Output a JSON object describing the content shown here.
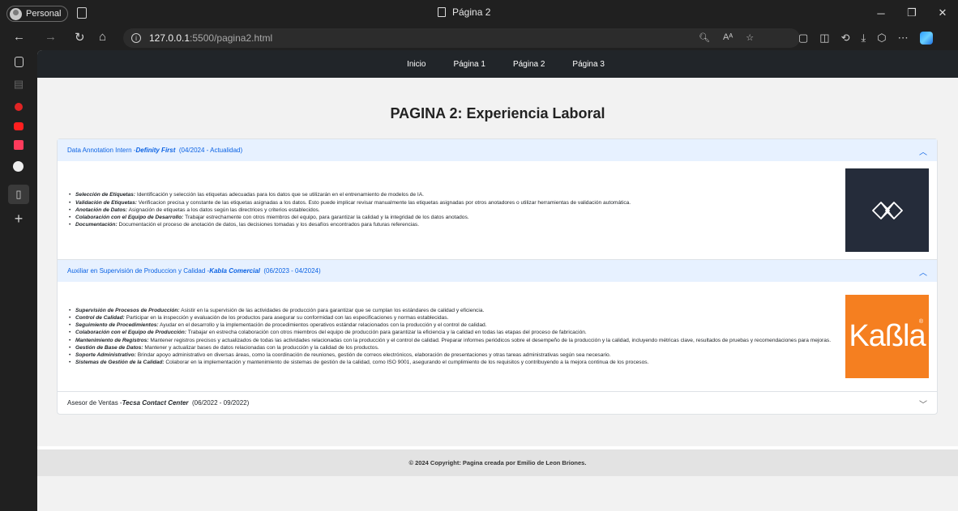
{
  "browser": {
    "profile_label": "Personal",
    "window_title": "Página 2",
    "url_host": "127.0.0.1",
    "url_path": ":5500/pagina2.html",
    "icons": [
      "back-icon",
      "forward-icon",
      "refresh-icon",
      "home-icon",
      "info-icon",
      "zoom-icon",
      "read-aloud-icon",
      "favorite-icon",
      "collections-icon",
      "split-screen-icon",
      "history-icon",
      "downloads-icon",
      "extensions-icon",
      "more-icon",
      "copilot-icon"
    ]
  },
  "sidebar": {
    "icons": [
      "tabs-icon",
      "workspace-icon",
      "youtube-icon",
      "youtube-icon",
      "app-icon",
      "github-icon",
      "page-icon",
      "add-icon"
    ]
  },
  "nav": {
    "links": [
      "Inicio",
      "Página 1",
      "Página 2",
      "Página 3"
    ]
  },
  "page": {
    "title": "PAGINA 2: Experiencia Laboral",
    "footer": "© 2024 Copyright: Pagina creada por Emilio de Leon Briones."
  },
  "jobs": [
    {
      "title": "Data Annotation Intern - ",
      "company": "Definity First",
      "dates": "  (04/2024 - Actualidad)",
      "expanded": true,
      "logo": "definity-first-logo",
      "duties": [
        {
          "label": "Selección de Etiquetas:",
          "text": " Identificación y selección las etiquetas adecuadas para los datos que se utilizarán en el entrenamiento de modelos de IA."
        },
        {
          "label": "Validación de Etiquetas:",
          "text": " Verificacion precisa y constante de las etiquetas asignadas a los datos. Esto puede implicar revisar manualmente las etiquetas asignadas por otros anotadores o utilizar herramientas de validación automática."
        },
        {
          "label": "Anotación de Datos:",
          "text": " Asignación de etiquetas a los datos según las directrices y criterios establecidos."
        },
        {
          "label": "Colaboración con el Equipo de Desarrollo:",
          "text": " Trabajar estrechamente con otros miembros del equipo, para garantizar la calidad y la integridad de los datos anotados."
        },
        {
          "label": "Documentación:",
          "text": " Documentación el proceso de anotación de datos, las decisiones tomadas y los desafíos encontrados para futuras referencias."
        }
      ]
    },
    {
      "title": "Auxiliar en Supervisión de Produccion y Calidad - ",
      "company": "Kabla Comercial",
      "dates": "  (06/2023 - 04/2024)",
      "expanded": true,
      "logo_text": "Kaßla",
      "logo_mark": "®",
      "duties": [
        {
          "label": "Supervisión de Procesos de Producción:",
          "text": " Asistir en la supervisión de las actividades de producción para garantizar que se cumplan los estándares de calidad y eficiencia."
        },
        {
          "label": "Control de Calidad:",
          "text": " Participar en la inspección y evaluación de los productos para asegurar su conformidad con las especificaciones y normas establecidas."
        },
        {
          "label": "Seguimiento de Procedimientos:",
          "text": " Ayudar en el desarrollo y la implementación de procedimientos operativos estándar relacionados con la producción y el control de calidad."
        },
        {
          "label": "Colaboración con el Equipo de Producción:",
          "text": " Trabajar en estrecha colaboración con otros miembros del equipo de producción para garantizar la eficiencia y la calidad en todas las etapas del proceso de fabricación."
        },
        {
          "label": "Mantenimiento de Registros:",
          "text": " Mantener registros precisos y actualizados de todas las actividades relacionadas con la producción y el control de calidad. Preparar informes periódicos sobre el desempeño de la producción y la calidad, incluyendo métricas clave, resultados de pruebas y recomendaciones para mejoras."
        },
        {
          "label": "Gestión de Base de Datos:",
          "text": " Mantener y actualizar bases de datos relacionadas con la producción y la calidad de los productos."
        },
        {
          "label": "Soporte Administrativo:",
          "text": " Brindar apoyo administrativo en diversas áreas, como la coordinación de reuniones, gestión de correos electrónicos, elaboración de presentaciones y otras tareas administrativas según sea necesario."
        },
        {
          "label": "Sistemas de Gestión de la Calidad:",
          "text": " Colaborar en la implementación y mantenimiento de sistemas de gestión de la calidad, como ISO 9001, asegurando el cumplimiento de los requisitos y contribuyendo a la mejora continua de los procesos."
        }
      ]
    },
    {
      "title": "Asesor de Ventas - ",
      "company": "Tecsa Contact Center",
      "dates": "  (06/2022 - 09/2022)",
      "expanded": false
    }
  ]
}
